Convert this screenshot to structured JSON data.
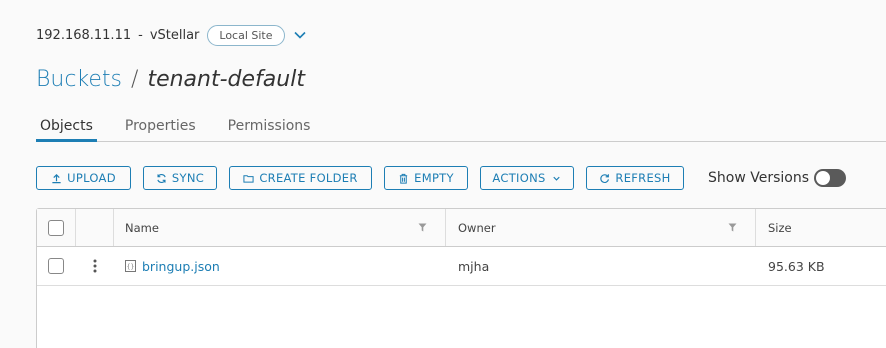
{
  "header": {
    "host": "192.168.11.11",
    "separator": "-",
    "system_name": "vStellar",
    "site_badge": "Local Site"
  },
  "breadcrumb": {
    "root": "Buckets",
    "separator": "/",
    "current": "tenant-default"
  },
  "tabs": [
    {
      "label": "Objects",
      "active": true
    },
    {
      "label": "Properties",
      "active": false
    },
    {
      "label": "Permissions",
      "active": false
    }
  ],
  "toolbar": {
    "upload": "UPLOAD",
    "sync": "SYNC",
    "create_folder": "CREATE FOLDER",
    "empty": "EMPTY",
    "actions": "ACTIONS",
    "refresh": "REFRESH",
    "show_versions": "Show Versions",
    "show_versions_on": false
  },
  "table": {
    "columns": {
      "name": "Name",
      "owner": "Owner",
      "size": "Size"
    },
    "rows": [
      {
        "name": "bringup.json",
        "owner": "mjha",
        "size": "95.63 KB"
      }
    ]
  },
  "colors": {
    "accent": "#1d7eb4",
    "toggle_off": "#5a5a5a"
  }
}
